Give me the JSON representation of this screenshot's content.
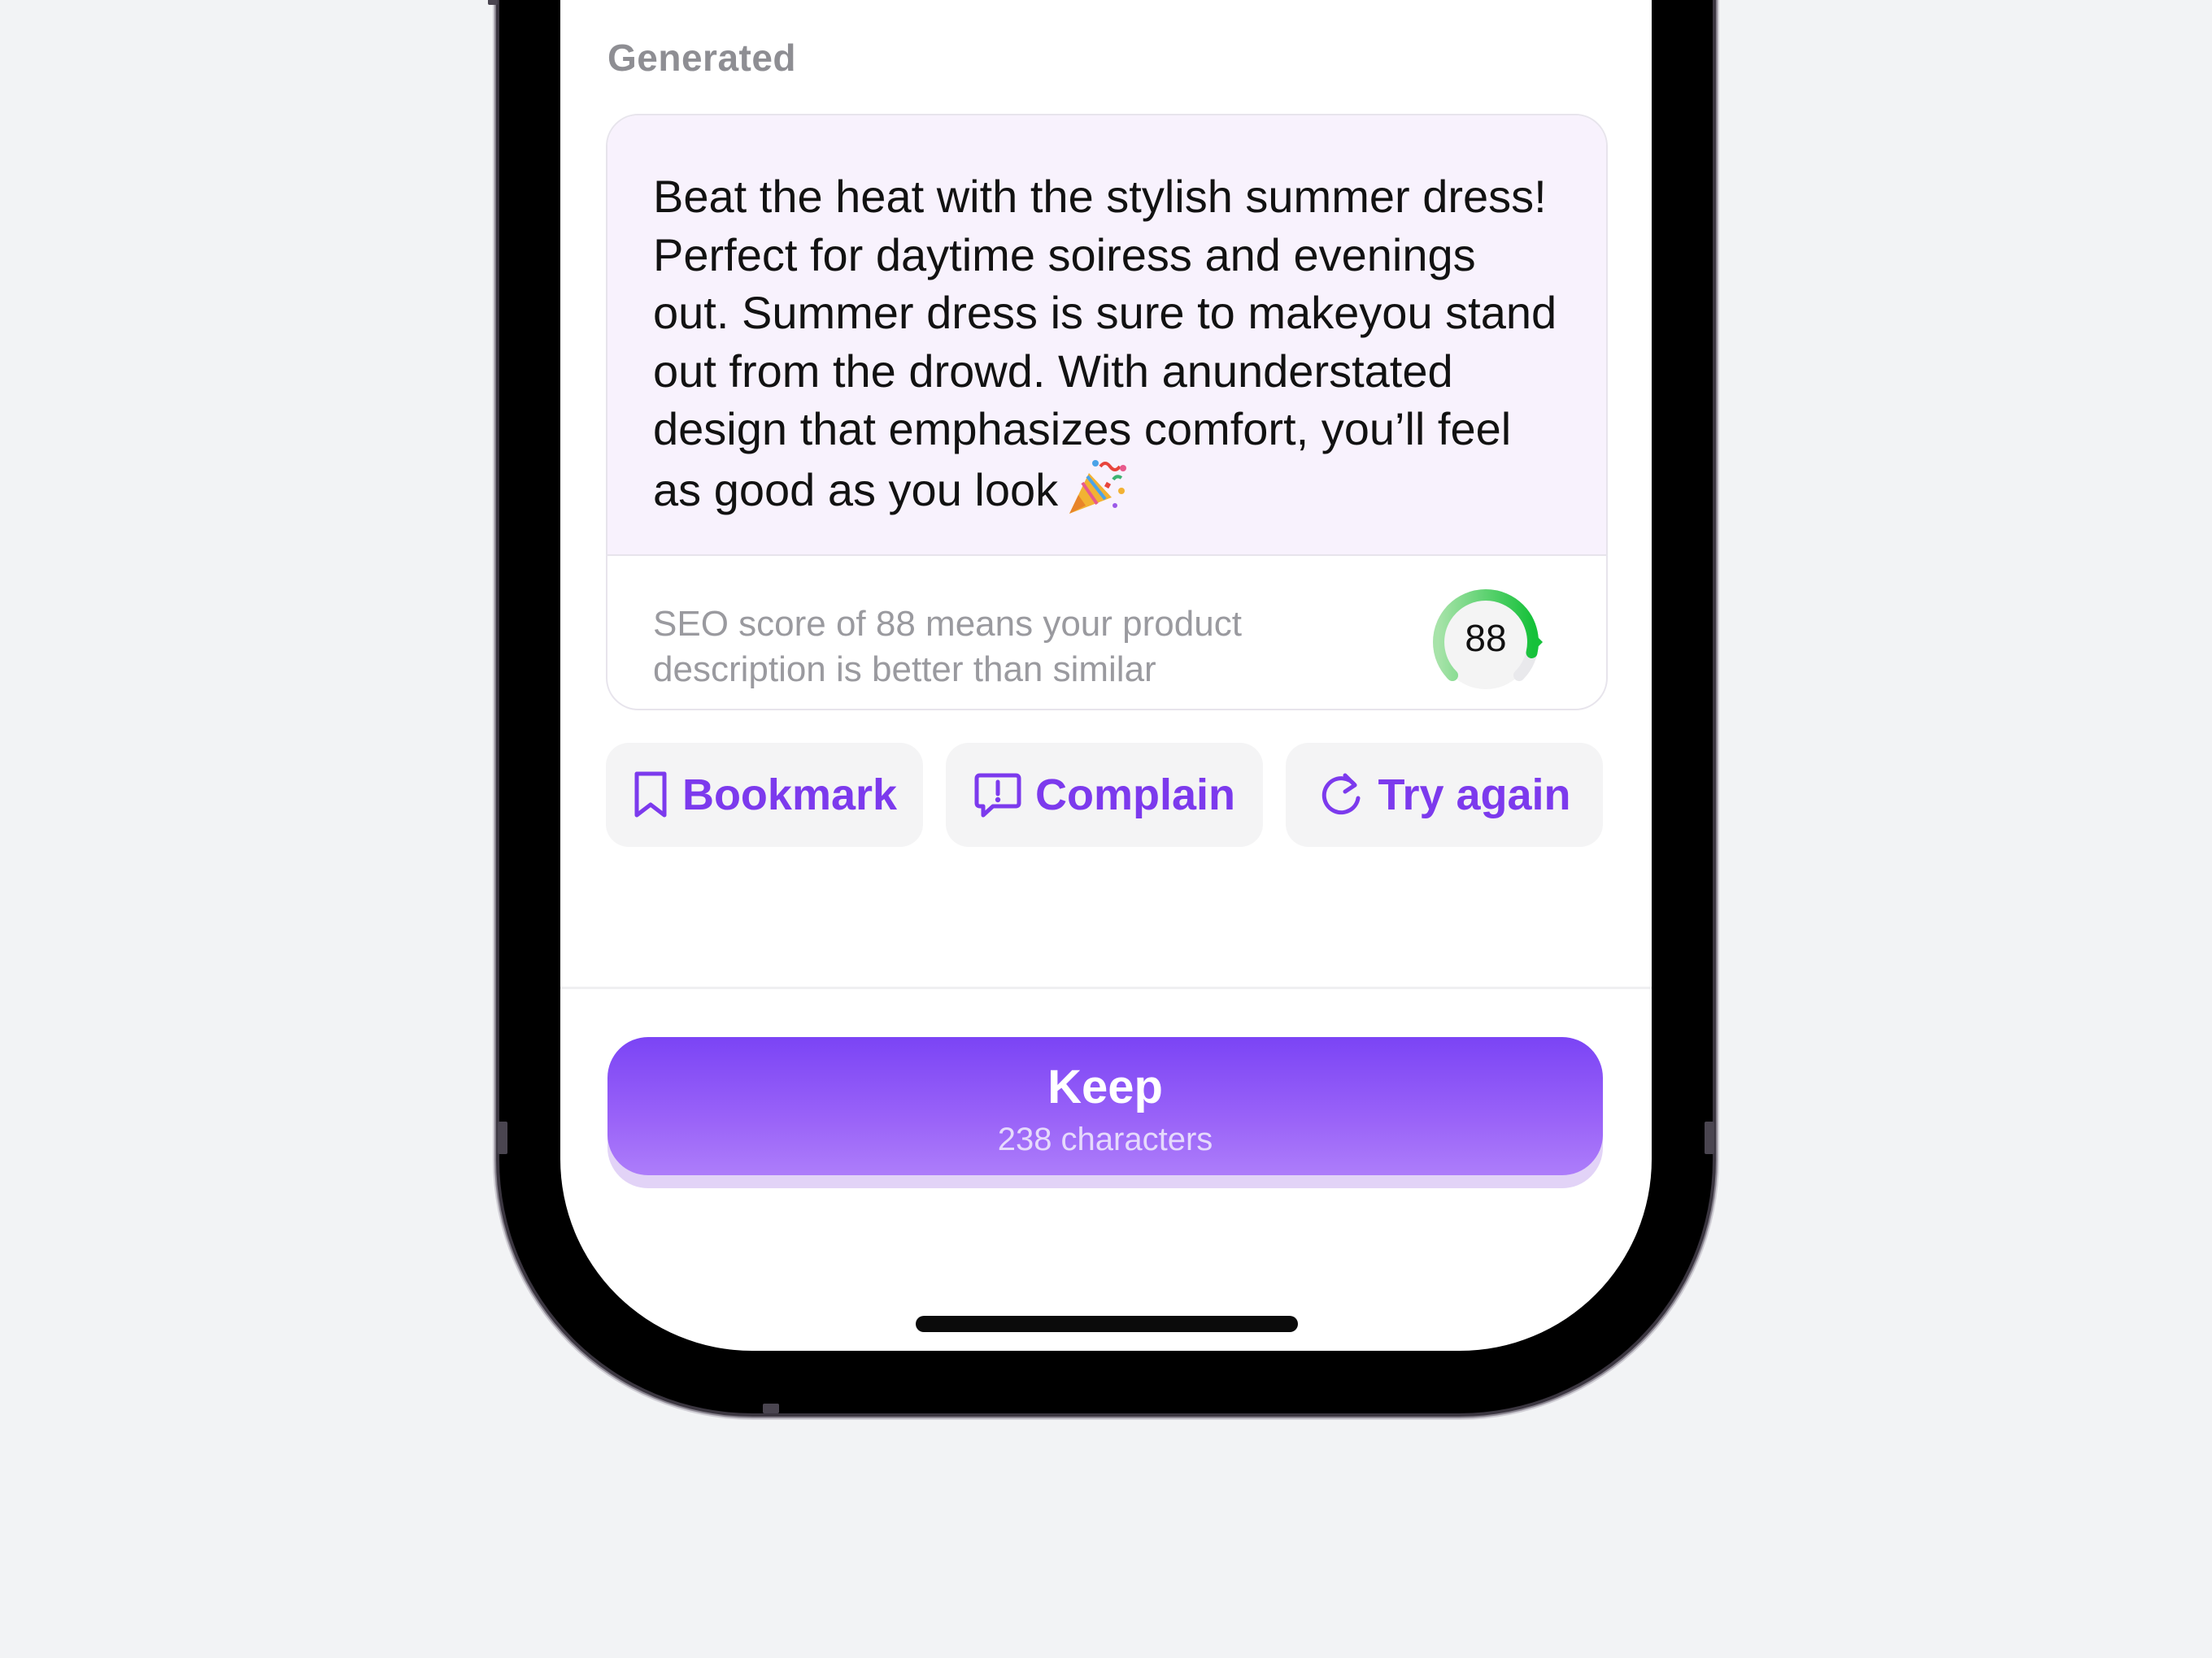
{
  "section": {
    "label": "Generated"
  },
  "card": {
    "description": "Beat the heat with the stylish summer dress! Perfect for daytime soiress and evenings out. Summer dress is sure to makeyou stand out from the drowd. With anunderstated design that emphasizes comfort, you’ll feel as good as you look",
    "emoji_icon": "party-popper-icon",
    "seo_text": "SEO score of 88 means your product description is better than similar",
    "seo_score": "88",
    "seo_score_fraction": 0.88,
    "gauge_color": "#22c55e"
  },
  "actions": {
    "bookmark_label": "Bookmark",
    "bookmark_icon": "bookmark-icon",
    "complain_label": "Complain",
    "complain_icon": "message-alert-icon",
    "try_again_label": "Try again",
    "try_again_icon": "refresh-icon"
  },
  "keep": {
    "label": "Keep",
    "count": "238 characters"
  },
  "colors": {
    "accent": "#7c3aed",
    "card_bg": "#f8f2fd",
    "page_bg": "#f2f3f5"
  }
}
